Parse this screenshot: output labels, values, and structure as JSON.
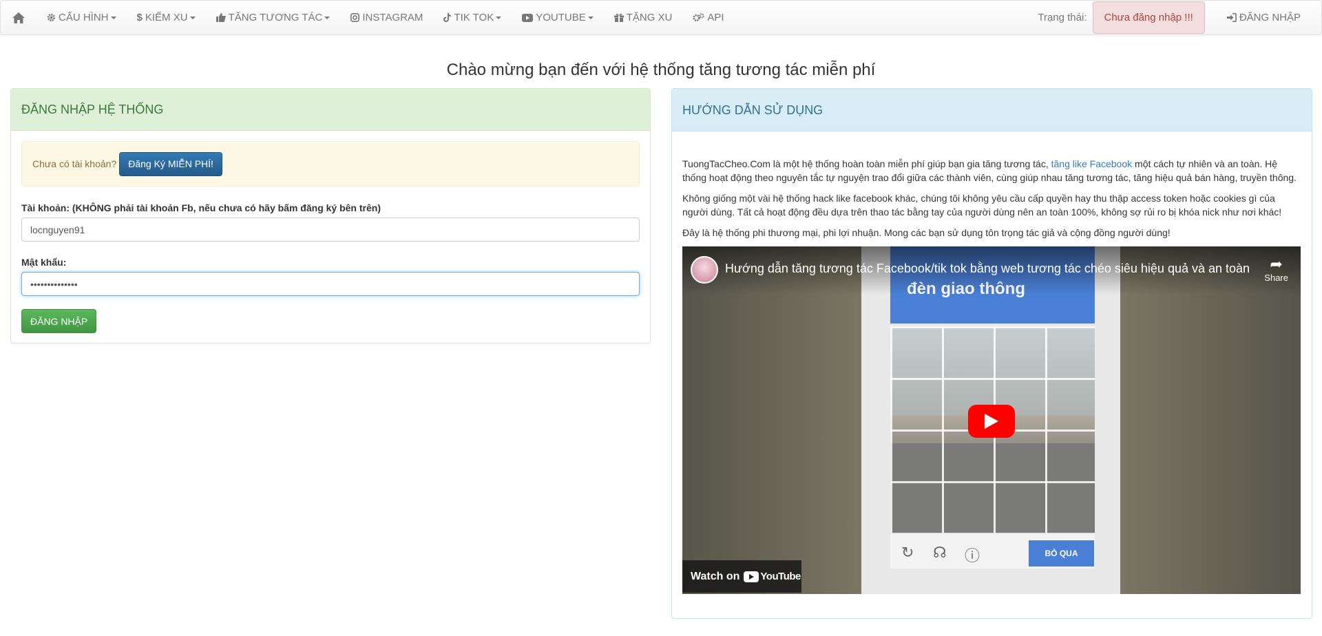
{
  "nav": {
    "items": [
      {
        "label": "CẤU HÌNH",
        "icon": "gear-icon",
        "dropdown": true
      },
      {
        "label": "KIẾM XU",
        "icon": "dollar-icon",
        "dropdown": true
      },
      {
        "label": "TĂNG TƯƠNG TÁC",
        "icon": "thumbs-up-icon",
        "dropdown": true
      },
      {
        "label": "INSTAGRAM",
        "icon": "instagram-icon",
        "dropdown": false
      },
      {
        "label": "TIK TOK",
        "icon": "tiktok-icon",
        "dropdown": true
      },
      {
        "label": "YOUTUBE",
        "icon": "youtube-icon",
        "dropdown": true
      },
      {
        "label": "TẶNG XU",
        "icon": "gift-icon",
        "dropdown": false
      },
      {
        "label": "API",
        "icon": "gears-icon",
        "dropdown": false
      }
    ],
    "status_label": "Trạng thái:",
    "status_value": "Chưa đăng nhập !!!",
    "login_label": "ĐĂNG NHẬP"
  },
  "headline": "Chào mừng bạn đến với hệ thống tăng tương tác miễn phí",
  "login_panel": {
    "title": "ĐĂNG NHẬP HỆ THỐNG",
    "no_account": "Chưa có tài khoản?",
    "register_button": "Đăng Ký MIỄN PHÍ!",
    "account_label": "Tài khoản: (KHÔNG phải tài khoản Fb, nếu chưa có hãy bấm đăng ký bên trên)",
    "account_value": "locnguyen91",
    "password_label": "Mật khẩu:",
    "password_value": "••••••••••••••",
    "login_button": "ĐĂNG NHẬP"
  },
  "guide_panel": {
    "title": "HƯỚNG DẪN SỬ DỤNG",
    "p1_before": "TuongTacCheo.Com là một hệ thống hoàn toàn miễn phí giúp bạn gia tăng tương tác, ",
    "p1_link": "tăng like Facebook",
    "p1_after": " một cách tự nhiên và an toàn. Hệ thống hoạt động theo nguyên tắc tự nguyện trao đổi giữa các thành viên, cùng giúp nhau tăng tương tác, tăng hiệu quả bán hàng, truyền thông.",
    "p2": "Không giống một vài hệ thống hack like facebook khác, chúng tôi không yêu cầu cấp quyền hay thu thập access token hoặc cookies gì của người dùng. Tất cả hoạt động đều dựa trên thao tác bằng tay của người dùng nên an toàn 100%, không sợ rủi ro bị khóa nick như nơi khác!",
    "p3": "Đây là hệ thống phi thương mại, phi lợi nhuận. Mong các bạn sử dụng tôn trọng tác giả và cộng đồng người dùng!"
  },
  "video": {
    "title": "Hướng dẫn tăng tương tác Facebook/tik tok bằng web tương tác chéo siêu hiệu quả và an toàn",
    "share_label": "Share",
    "captcha_text": "đèn giao thông",
    "skip_label": "BỎ QUA",
    "watch_on": "Watch on",
    "youtube_label": "YouTube"
  }
}
